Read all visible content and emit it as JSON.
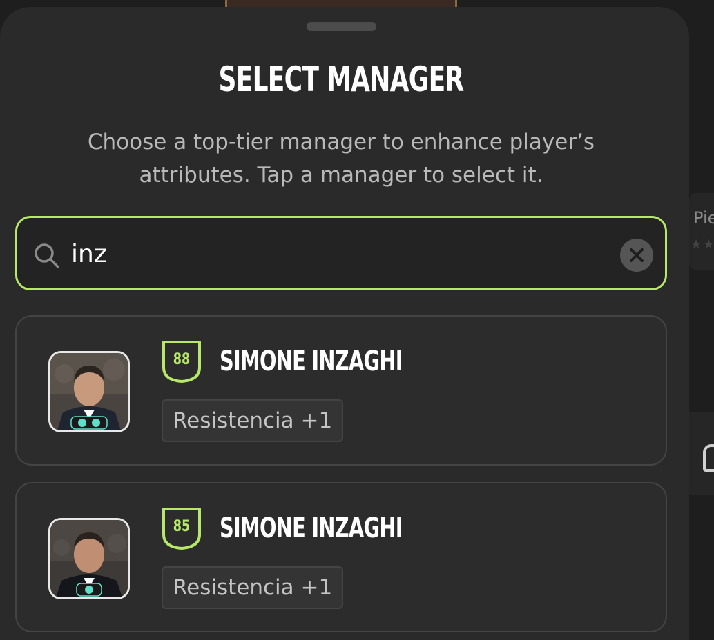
{
  "sheet": {
    "title": "SELECT MANAGER",
    "subtitle": "Choose a top-tier manager to enhance player’s attributes. Tap a manager to select it."
  },
  "search": {
    "value": "inz",
    "icon": "search-icon",
    "clear_icon": "close-icon"
  },
  "background": {
    "card_label": "Pie",
    "card_stars": "★★"
  },
  "managers": [
    {
      "rating": "88",
      "name": "SIMONE INZAGHI",
      "attribute": "Resistencia +1",
      "badges": 2
    },
    {
      "rating": "85",
      "name": "SIMONE INZAGHI",
      "attribute": "Resistencia +1",
      "badges": 1
    }
  ],
  "colors": {
    "accent": "#b7e868",
    "sheet_bg": "#2a2a2a",
    "card_bg": "#2c2c2c",
    "badge_teal": "#5ee0c8"
  }
}
